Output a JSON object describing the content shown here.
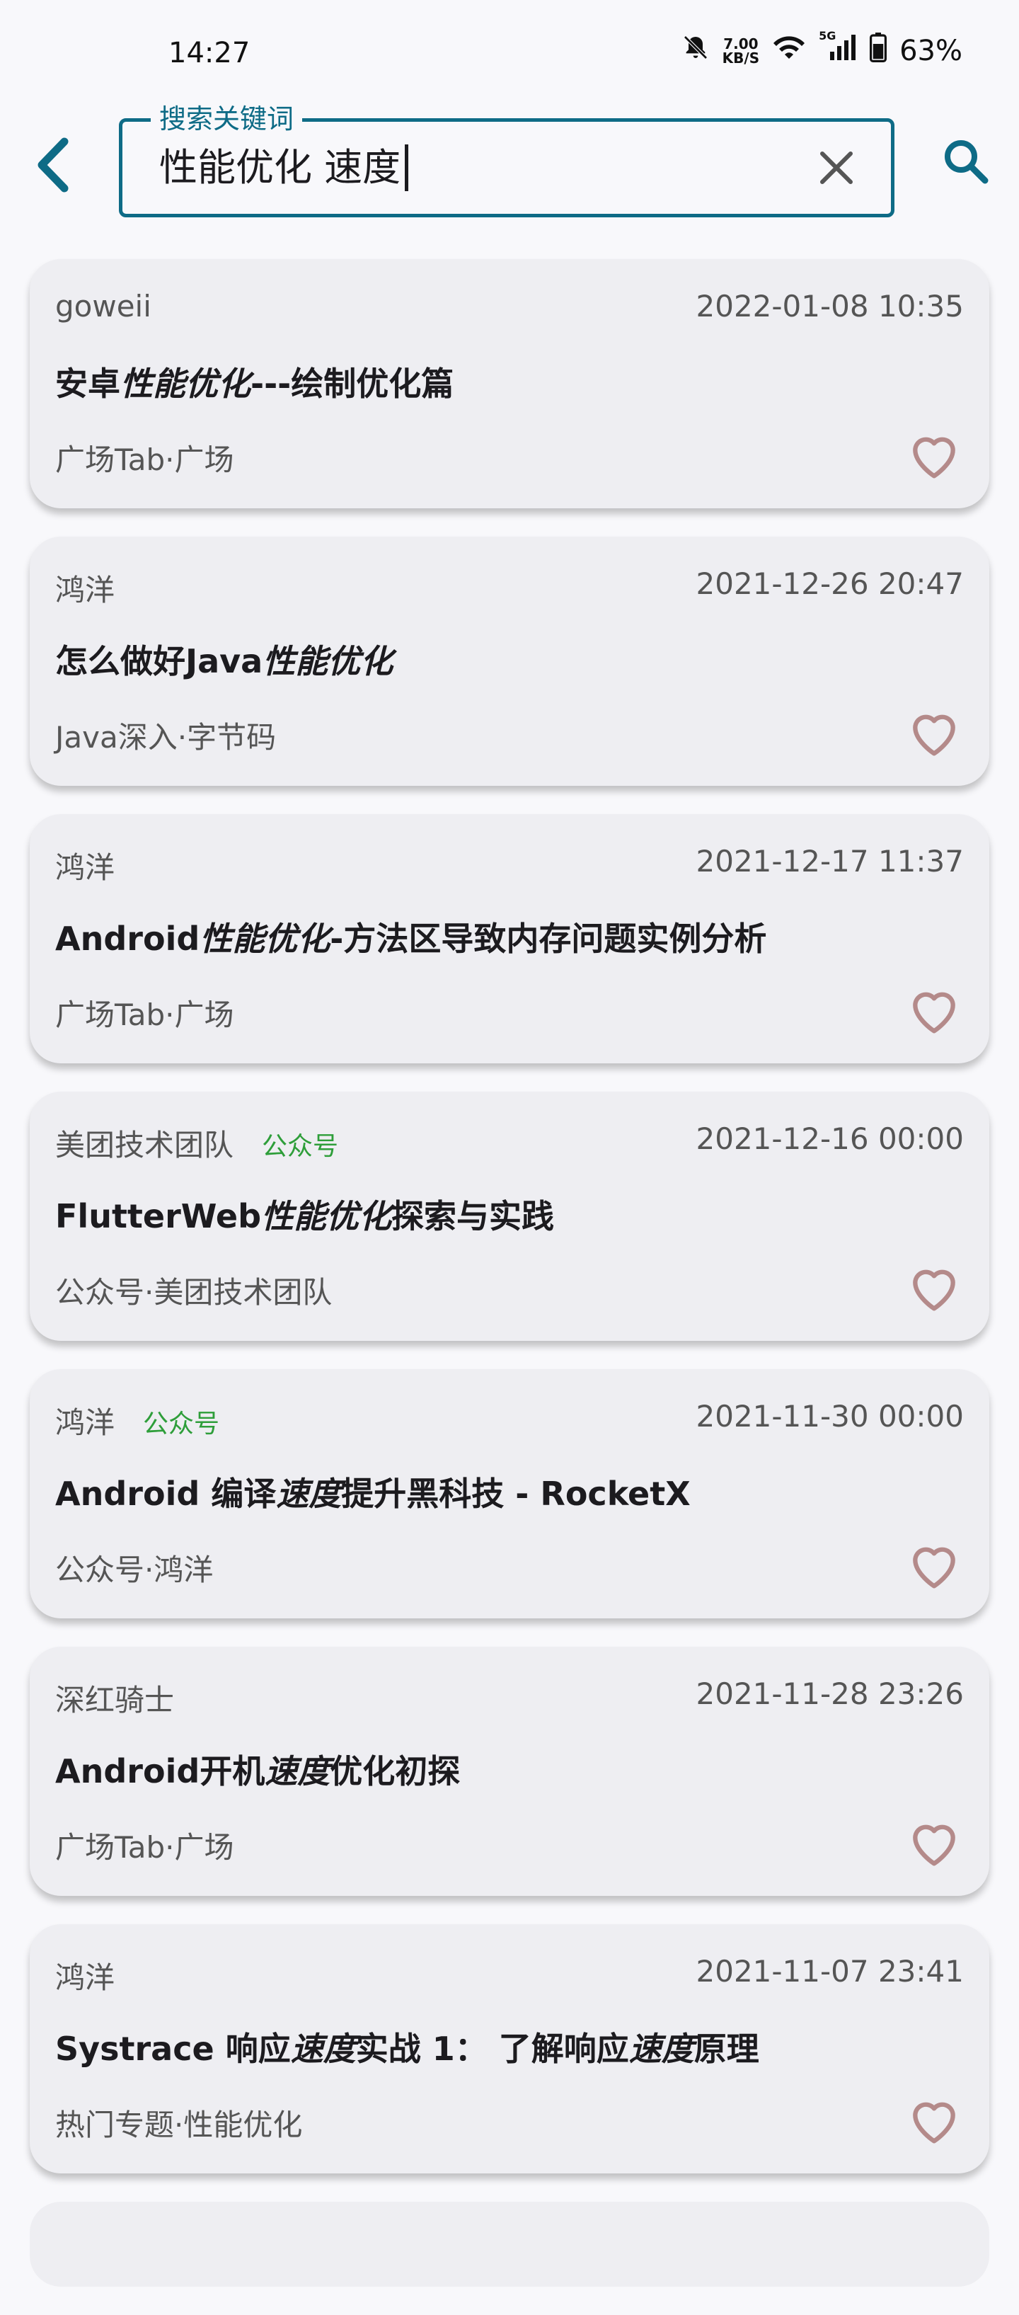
{
  "status_bar": {
    "time": "14:27",
    "net_speed_value": "7.00",
    "net_speed_unit": "KB/S",
    "signal_label": "5G",
    "battery": "63%"
  },
  "search": {
    "label": "搜索关键词",
    "value": "性能优化 速度"
  },
  "colors": {
    "accent": "#0e6b86",
    "card_bg": "#eeeef2",
    "tag_green": "#2e9e3a",
    "heart": "#b48a8a"
  },
  "articles": [
    {
      "author": "goweii",
      "tag": "",
      "time": "2022-01-08 10:35",
      "title_parts": [
        "安卓",
        "性能优化",
        "---绘制优化篇",
        "",
        ""
      ],
      "chapter": "广场Tab·广场"
    },
    {
      "author": "鸿洋",
      "tag": "",
      "time": "2021-12-26 20:47",
      "title_parts": [
        "怎么做好Java",
        "性能优化",
        "",
        "",
        ""
      ],
      "chapter": "Java深入·字节码"
    },
    {
      "author": "鸿洋",
      "tag": "",
      "time": "2021-12-17 11:37",
      "title_parts": [
        "Android",
        "性能优化",
        "-方法区导致内存问题实例分析",
        "",
        ""
      ],
      "chapter": "广场Tab·广场"
    },
    {
      "author": "美团技术团队",
      "tag": "公众号",
      "time": "2021-12-16 00:00",
      "title_parts": [
        "FlutterWeb",
        "性能优化",
        "探索与实践",
        "",
        ""
      ],
      "chapter": "公众号·美团技术团队"
    },
    {
      "author": "鸿洋",
      "tag": "公众号",
      "time": "2021-11-30 00:00",
      "title_parts": [
        "Android 编译",
        "速度",
        "提升黑科技 - RocketX",
        "",
        ""
      ],
      "chapter": "公众号·鸿洋"
    },
    {
      "author": "深红骑士",
      "tag": "",
      "time": "2021-11-28 23:26",
      "title_parts": [
        "Android开机",
        "速度",
        "优化初探",
        "",
        ""
      ],
      "chapter": "广场Tab·广场"
    },
    {
      "author": "鸿洋",
      "tag": "",
      "time": "2021-11-07 23:41",
      "title_parts": [
        "Systrace 响应",
        "速度",
        "实战 1： 了解响应",
        "速度",
        "原理"
      ],
      "chapter": "热门专题·性能优化"
    }
  ]
}
